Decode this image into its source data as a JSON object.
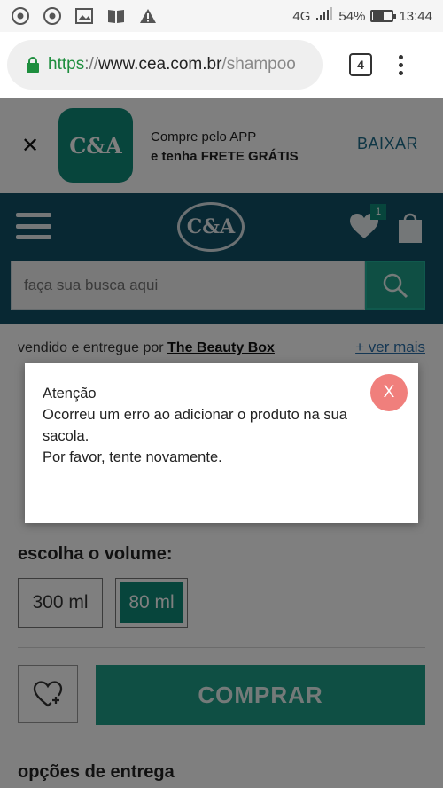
{
  "status_bar": {
    "network": "4G",
    "battery": "54%",
    "time": "13:44",
    "icons": [
      "chrome-icon",
      "chrome-icon",
      "image-icon",
      "book-icon",
      "warning-icon"
    ]
  },
  "browser": {
    "url_scheme": "https",
    "url_sep": "://",
    "url_host": "www.cea.com.br",
    "url_path": "/shampoo",
    "tab_count": "4"
  },
  "app_banner": {
    "line1": "Compre pelo APP",
    "line2_prefix": "e tenha ",
    "line2_bold": "FRETE GRÁTIS",
    "cta": "BAIXAR",
    "logo_text": "C&A"
  },
  "header": {
    "logo_text": "C&A",
    "wishlist_count": "1",
    "search_placeholder": "faça sua busca aqui"
  },
  "product": {
    "seller_prefix": "vendido e entregue por ",
    "seller_name": "The Beauty Box",
    "see_more": "+ ver mais",
    "volume_label": "escolha o volume:",
    "volumes": [
      "300 ml",
      "80 ml"
    ],
    "selected_volume": "80 ml",
    "buy_label": "COMPRAR",
    "delivery_label": "opções de entrega"
  },
  "modal": {
    "title": "Atenção",
    "line1": "Ocorreu um erro ao adicionar o produto na sua",
    "line2": "sacola.",
    "line3": "Por favor, tente novamente.",
    "close_label": "X"
  },
  "colors": {
    "brand_teal": "#105166",
    "accent_green": "#1f9e88",
    "close_red": "#f07f7c"
  }
}
